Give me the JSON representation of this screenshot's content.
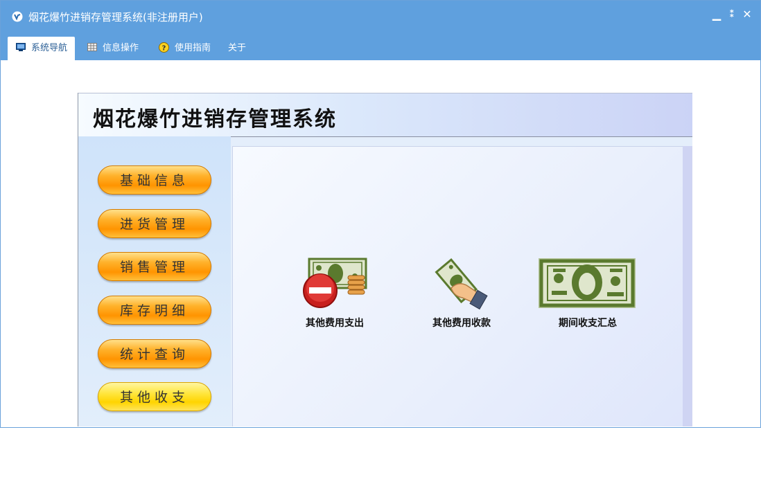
{
  "window": {
    "title": "烟花爆竹进销存管理系统(非注册用户)",
    "controls": {
      "minimize": "▁",
      "restore": "⁑",
      "close": "✕"
    }
  },
  "menu": {
    "tabs": [
      {
        "label": "系统导航",
        "icon": "monitor-icon",
        "active": true
      },
      {
        "label": "信息操作",
        "icon": "grid-icon",
        "active": false
      },
      {
        "label": "使用指南",
        "icon": "help-icon",
        "active": false
      },
      {
        "label": "关于",
        "icon": "",
        "active": false
      }
    ]
  },
  "panel": {
    "title": "烟花爆竹进销存管理系统",
    "nav_buttons": [
      {
        "label": "基础信息",
        "active": false
      },
      {
        "label": "进货管理",
        "active": false
      },
      {
        "label": "销售管理",
        "active": false
      },
      {
        "label": "库存明细",
        "active": false
      },
      {
        "label": "统计查询",
        "active": false
      },
      {
        "label": "其他收支",
        "active": true
      }
    ],
    "functions": [
      {
        "label": "其他费用支出",
        "icon": "money-expense-icon"
      },
      {
        "label": "其他费用收款",
        "icon": "money-receive-icon"
      },
      {
        "label": "期间收支汇总",
        "icon": "banknote-icon"
      }
    ]
  },
  "colors": {
    "titlebar": "#5fa0de",
    "nav_button_orange": "#ff9400",
    "nav_button_active_yellow": "#ffd400",
    "banknote_green": "#5a7a2e"
  }
}
